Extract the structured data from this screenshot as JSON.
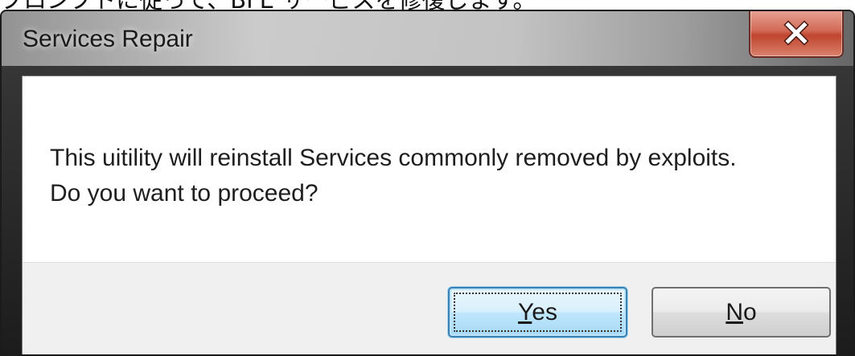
{
  "caption": "プロンプトに従って、BFE サービスを修復します。",
  "window": {
    "title": "Services Repair",
    "close_icon": "close-icon"
  },
  "message": {
    "line1": "This uitility will reinstall Services commonly removed by exploits.",
    "line2": "Do you want to proceed?"
  },
  "buttons": {
    "yes": {
      "accel": "Y",
      "rest": "es"
    },
    "no": {
      "accel": "N",
      "rest": "o"
    }
  },
  "colors": {
    "close_button": "#c0452f",
    "default_button_border": "#3c7fb1"
  }
}
